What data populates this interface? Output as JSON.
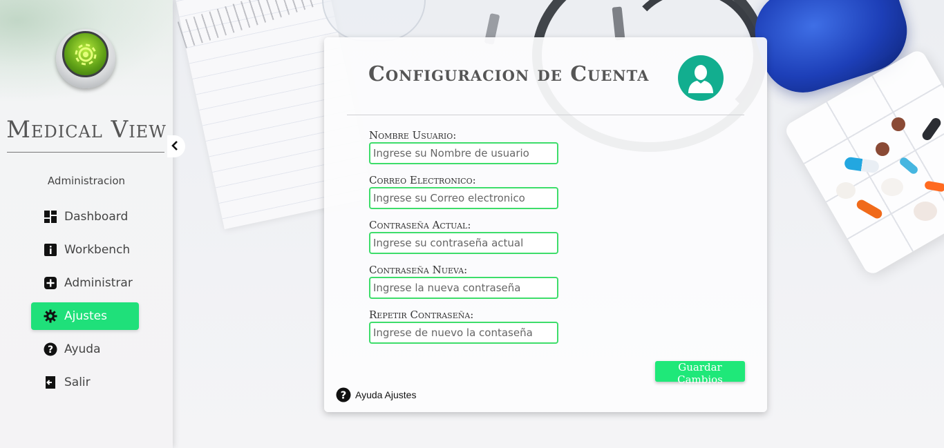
{
  "brand": {
    "name": "Medical View"
  },
  "sidebar": {
    "section_title": "Administracion",
    "collapse_icon": "chevron-left-icon",
    "items": [
      {
        "label": "Dashboard",
        "icon": "dashboard-icon",
        "active": false
      },
      {
        "label": "Workbench",
        "icon": "info-icon",
        "active": false
      },
      {
        "label": "Administrar",
        "icon": "plus-square-icon",
        "active": false
      },
      {
        "label": "Ajustes",
        "icon": "gear-icon",
        "active": true
      },
      {
        "label": "Ayuda",
        "icon": "question-circle-icon",
        "active": false
      },
      {
        "label": "Salir",
        "icon": "exit-icon",
        "active": false
      }
    ]
  },
  "card": {
    "title": "Configuracion de Cuenta",
    "avatar_icon": "user-icon",
    "fields": [
      {
        "label": "Nombre Usuario:",
        "placeholder": "Ingrese su Nombre de usuario",
        "value": ""
      },
      {
        "label": "Correo Electronico:",
        "placeholder": "Ingrese su Correo electronico",
        "value": ""
      },
      {
        "label": "Contraseña Actual:",
        "placeholder": "Ingrese su contraseña actual",
        "value": ""
      },
      {
        "label": "Contraseña Nueva:",
        "placeholder": "Ingrese la nueva contraseña",
        "value": ""
      },
      {
        "label": "Repetir Contraseña:",
        "placeholder": "Ingrese de nuevo la contaseña",
        "value": ""
      }
    ],
    "save_label": "Guardar Cambios",
    "help_label": "Ayuda Ajustes"
  },
  "colors": {
    "accent": "#1fe07a",
    "input_border": "#3ddd6a",
    "avatar_bg": "#12ae8f",
    "text": "#555555"
  }
}
